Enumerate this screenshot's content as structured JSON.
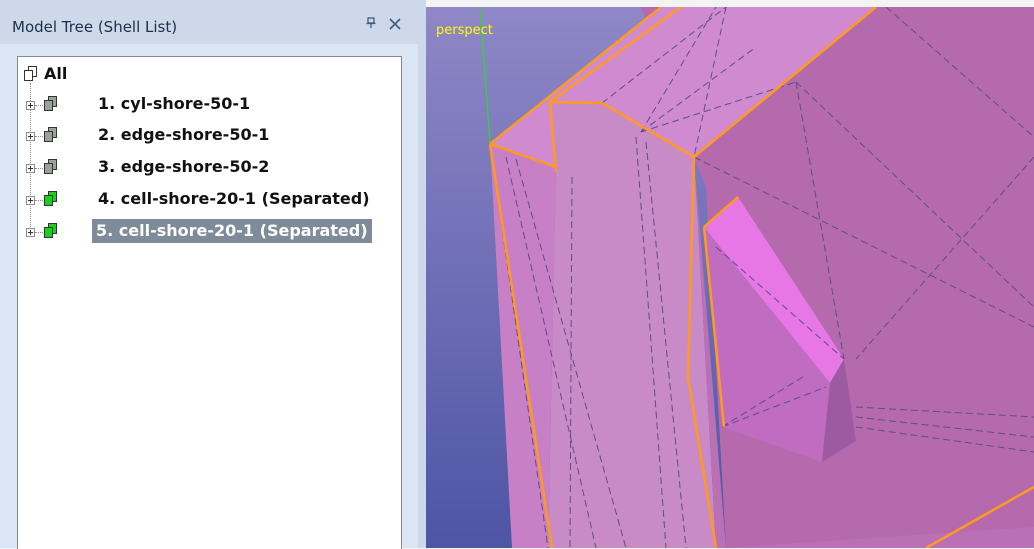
{
  "panel": {
    "title": "Model Tree (Shell List)",
    "pin_icon": "pin-icon",
    "close_icon": "close-icon"
  },
  "tree": {
    "root": {
      "label": "All",
      "icon": "shell-list-icon"
    },
    "items": [
      {
        "label": "1. cyl-shore-50-1",
        "icon": "shell-icon",
        "color": "#9aa29a",
        "selected": false
      },
      {
        "label": "2. edge-shore-50-1",
        "icon": "shell-icon",
        "color": "#9aa29a",
        "selected": false
      },
      {
        "label": "3. edge-shore-50-2",
        "icon": "shell-icon",
        "color": "#9aa29a",
        "selected": false
      },
      {
        "label": "4. cell-shore-20-1 (Separated)",
        "icon": "shell-icon",
        "color": "#1fcf1f",
        "selected": false
      },
      {
        "label": "5. cell-shore-20-1 (Separated)",
        "icon": "shell-icon",
        "color": "#1fcf1f",
        "selected": true
      }
    ]
  },
  "viewport": {
    "view_mode": "perspect",
    "colors": {
      "background_top": "#8f87c6",
      "background_bottom": "#4d55a5",
      "surface": "#cf82cf",
      "edge_highlight": "#ff9a1f",
      "axis": "#2fd62f"
    }
  }
}
